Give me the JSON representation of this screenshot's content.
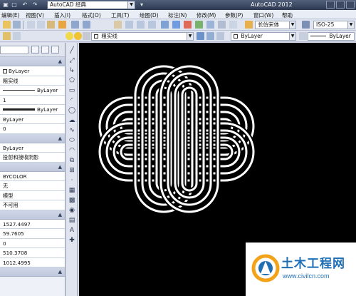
{
  "titlebar": {
    "workspace": "AutoCAD 经典",
    "app_title": "AutoCAD 2012"
  },
  "menubar": {
    "items": [
      "编辑(E)",
      "视图(V)",
      "插入(I)",
      "格式(O)",
      "工具(T)",
      "绘图(D)",
      "标注(N)",
      "修改(M)",
      "参数(P)",
      "窗口(W)",
      "帮助"
    ]
  },
  "toolbar1": {
    "text_style": "长仿宋体",
    "dim_style": "ISO-25"
  },
  "toolbar2": {
    "layer": "粗实线",
    "color": "ByLayer",
    "linetype": "ByLayer"
  },
  "palette": {
    "general": {
      "color": "ByLayer",
      "layer": "粗实线",
      "linetype": "ByLayer",
      "linetype_scale": "1",
      "lineweight": "ByLayer",
      "transparency": "ByLayer",
      "thickness": "0"
    },
    "visualization": {
      "material": "ByLayer",
      "shadow": "投射和接收阴影"
    },
    "plot": {
      "plot_style": "BYCOLOR",
      "plot_style_table": "无",
      "plot_table_attached": "模型",
      "plot_table_type": "不可用"
    },
    "view": {
      "center_x": "1527.4497",
      "center_y": "59.7605",
      "center_z": "0",
      "height": "510.3708",
      "width": "1012.4995"
    }
  },
  "watermark": {
    "title": "土木工程网",
    "url": "www.civilcn.com"
  }
}
